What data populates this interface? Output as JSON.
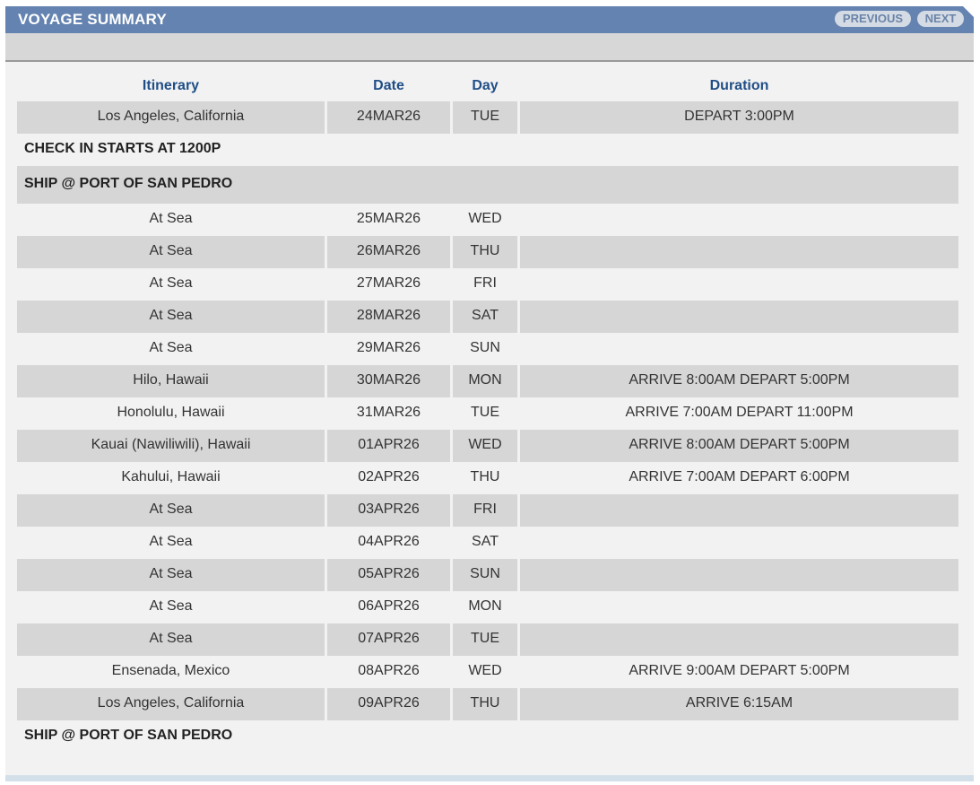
{
  "header": {
    "title": "VOYAGE SUMMARY",
    "previous_label": "PREVIOUS",
    "next_label": "NEXT"
  },
  "columns": {
    "itinerary": "Itinerary",
    "date": "Date",
    "day": "Day",
    "duration": "Duration"
  },
  "rows": [
    {
      "kind": "stop",
      "itinerary": "Los Angeles, California",
      "date": "24MAR26",
      "day": "TUE",
      "duration": "DEPART 3:00PM",
      "shaded": true
    },
    {
      "kind": "note",
      "text": "CHECK IN STARTS AT 1200P",
      "shaded": false
    },
    {
      "kind": "note",
      "text": "SHIP @ PORT OF SAN PEDRO",
      "shaded": true
    },
    {
      "kind": "stop",
      "itinerary": "At Sea",
      "date": "25MAR26",
      "day": "WED",
      "duration": "",
      "shaded": false
    },
    {
      "kind": "stop",
      "itinerary": "At Sea",
      "date": "26MAR26",
      "day": "THU",
      "duration": "",
      "shaded": true
    },
    {
      "kind": "stop",
      "itinerary": "At Sea",
      "date": "27MAR26",
      "day": "FRI",
      "duration": "",
      "shaded": false
    },
    {
      "kind": "stop",
      "itinerary": "At Sea",
      "date": "28MAR26",
      "day": "SAT",
      "duration": "",
      "shaded": true
    },
    {
      "kind": "stop",
      "itinerary": "At Sea",
      "date": "29MAR26",
      "day": "SUN",
      "duration": "",
      "shaded": false
    },
    {
      "kind": "stop",
      "itinerary": "Hilo, Hawaii",
      "date": "30MAR26",
      "day": "MON",
      "duration": "ARRIVE 8:00AM DEPART 5:00PM",
      "shaded": true
    },
    {
      "kind": "stop",
      "itinerary": "Honolulu, Hawaii",
      "date": "31MAR26",
      "day": "TUE",
      "duration": "ARRIVE 7:00AM DEPART 11:00PM",
      "shaded": false
    },
    {
      "kind": "stop",
      "itinerary": "Kauai (Nawiliwili), Hawaii",
      "date": "01APR26",
      "day": "WED",
      "duration": "ARRIVE 8:00AM DEPART 5:00PM",
      "shaded": true
    },
    {
      "kind": "stop",
      "itinerary": "Kahului, Hawaii",
      "date": "02APR26",
      "day": "THU",
      "duration": "ARRIVE 7:00AM DEPART 6:00PM",
      "shaded": false
    },
    {
      "kind": "stop",
      "itinerary": "At Sea",
      "date": "03APR26",
      "day": "FRI",
      "duration": "",
      "shaded": true
    },
    {
      "kind": "stop",
      "itinerary": "At Sea",
      "date": "04APR26",
      "day": "SAT",
      "duration": "",
      "shaded": false
    },
    {
      "kind": "stop",
      "itinerary": "At Sea",
      "date": "05APR26",
      "day": "SUN",
      "duration": "",
      "shaded": true
    },
    {
      "kind": "stop",
      "itinerary": "At Sea",
      "date": "06APR26",
      "day": "MON",
      "duration": "",
      "shaded": false
    },
    {
      "kind": "stop",
      "itinerary": "At Sea",
      "date": "07APR26",
      "day": "TUE",
      "duration": "",
      "shaded": true
    },
    {
      "kind": "stop",
      "itinerary": "Ensenada, Mexico",
      "date": "08APR26",
      "day": "WED",
      "duration": "ARRIVE 9:00AM DEPART 5:00PM",
      "shaded": false
    },
    {
      "kind": "stop",
      "itinerary": "Los Angeles, California",
      "date": "09APR26",
      "day": "THU",
      "duration": "ARRIVE 6:15AM",
      "shaded": true
    },
    {
      "kind": "note",
      "text": "SHIP @ PORT OF SAN PEDRO",
      "shaded": false
    }
  ]
}
